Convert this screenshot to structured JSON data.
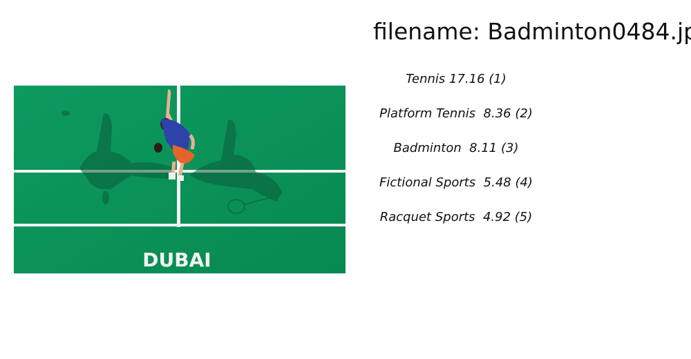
{
  "header": {
    "filename_text": "filename: Badminton0484.jp"
  },
  "image": {
    "watermark_logo": "DUBAI",
    "court_color": "#0a9a5e",
    "line_color": "#ffffff"
  },
  "predictions": [
    {
      "label": "Tennis",
      "score": "17.16",
      "rank": "(1)",
      "text": "Tennis 17.16 (1)"
    },
    {
      "label": "Platform Tennis",
      "score": "8.36",
      "rank": "(2)",
      "text": "Platform Tennis  8.36 (2)"
    },
    {
      "label": "Badminton",
      "score": "8.11",
      "rank": "(3)",
      "text": "Badminton  8.11 (3)"
    },
    {
      "label": "Fictional Sports",
      "score": "5.48",
      "rank": "(4)",
      "text": "Fictional Sports  5.48 (4)"
    },
    {
      "label": "Racquet Sports",
      "score": "4.92",
      "rank": "(5)",
      "text": "Racquet Sports  4.92 (5)"
    }
  ]
}
